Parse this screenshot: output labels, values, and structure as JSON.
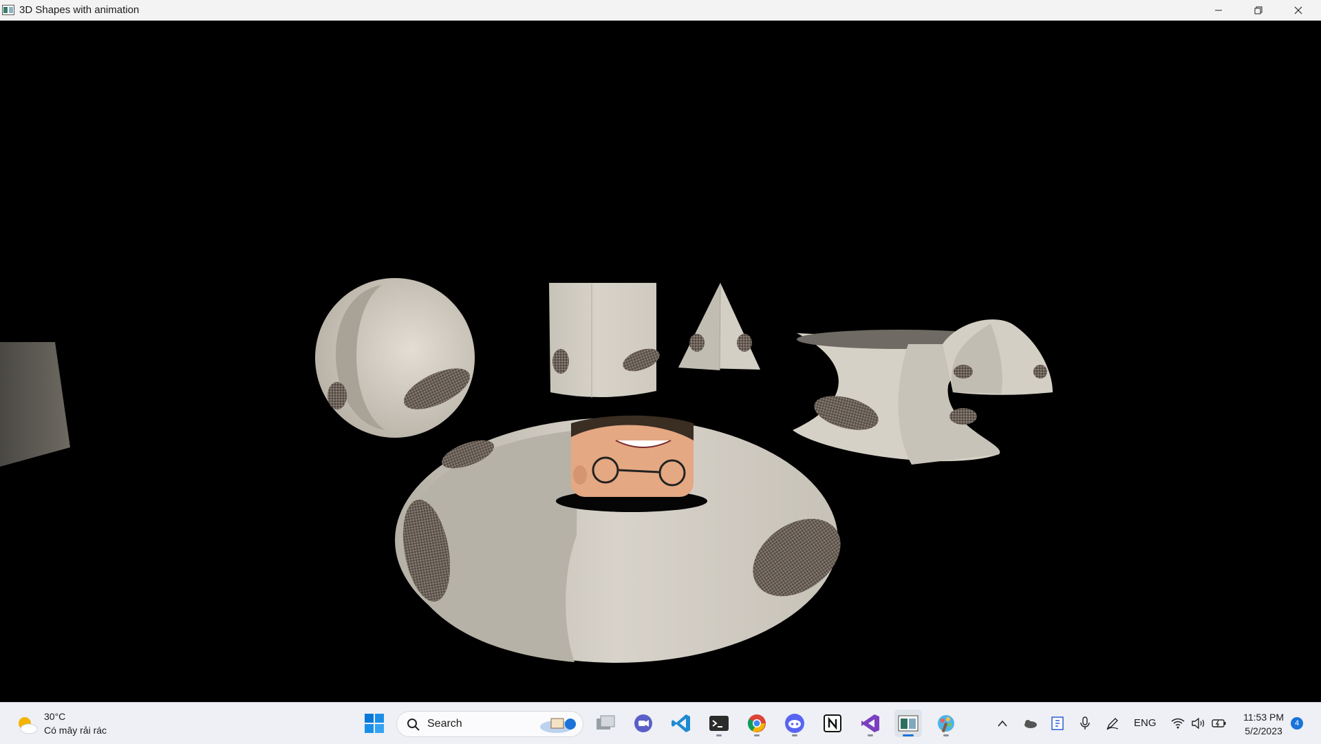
{
  "window": {
    "title": "3D Shapes with animation",
    "controls": [
      "minimize",
      "restore",
      "close"
    ]
  },
  "scene": {
    "background": "#000000",
    "texture_base": "#d9d4cb",
    "objects": [
      "cube",
      "sphere",
      "cylinder",
      "cone",
      "hyperboloid",
      "mobius-shape",
      "torus"
    ]
  },
  "taskbar": {
    "weather": {
      "temp": "30°C",
      "condition": "Có mây rải rác"
    },
    "search": {
      "label": "Search"
    },
    "apps": [
      "start-menu",
      "task-view",
      "teams-chat",
      "vscode",
      "terminal",
      "chrome",
      "discord",
      "notion",
      "visual-studio",
      "opengl-app",
      "paint"
    ],
    "tray": {
      "language": "ENG",
      "time": "11:53 PM",
      "date": "5/2/2023",
      "notifications": "4"
    }
  }
}
